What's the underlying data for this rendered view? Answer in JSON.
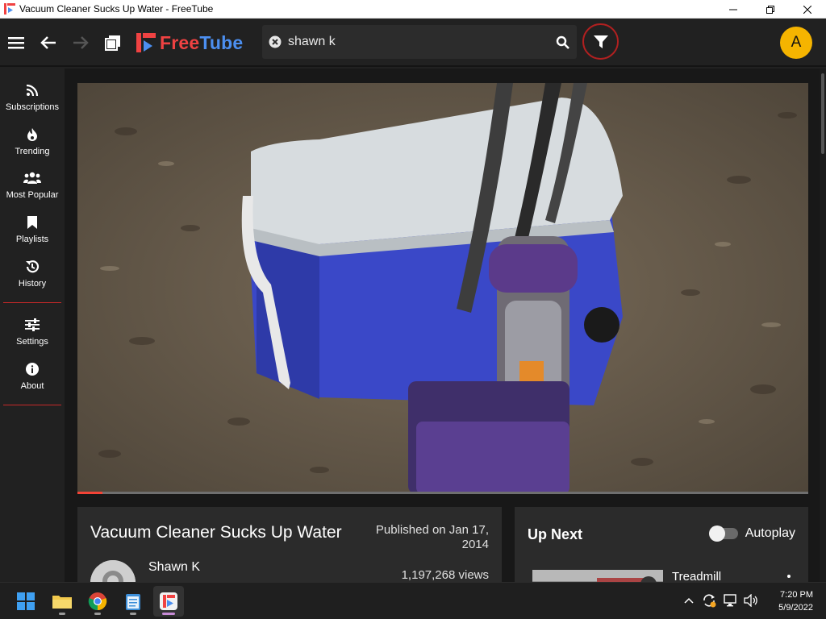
{
  "window": {
    "title": "Vacuum Cleaner Sucks Up Water - FreeTube"
  },
  "header": {
    "logo_free": "Free",
    "logo_tube": "Tube",
    "search_query": "shawn k",
    "avatar_letter": "A"
  },
  "sidebar": {
    "items": [
      {
        "label": "Subscriptions",
        "icon": "rss-icon"
      },
      {
        "label": "Trending",
        "icon": "fire-icon"
      },
      {
        "label": "Most Popular",
        "icon": "users-icon"
      },
      {
        "label": "Playlists",
        "icon": "bookmark-icon"
      },
      {
        "label": "History",
        "icon": "history-icon"
      },
      {
        "label": "Settings",
        "icon": "sliders-icon"
      },
      {
        "label": "About",
        "icon": "info-icon"
      }
    ]
  },
  "video": {
    "title": "Vacuum Cleaner Sucks Up Water",
    "published": "Published on Jan 17, 2014",
    "channel": "Shawn K",
    "views": "1,197,268 views",
    "progress_fraction": 0.034
  },
  "upnext": {
    "heading": "Up Next",
    "autoplay_label": "Autoplay",
    "autoplay_on": false,
    "first_title": "Treadmill"
  },
  "taskbar": {
    "time": "7:20 PM",
    "date": "5/9/2022"
  },
  "colors": {
    "accent_red": "#f04242",
    "accent_blue": "#4c8ff0",
    "avatar_yellow": "#f5b400"
  }
}
